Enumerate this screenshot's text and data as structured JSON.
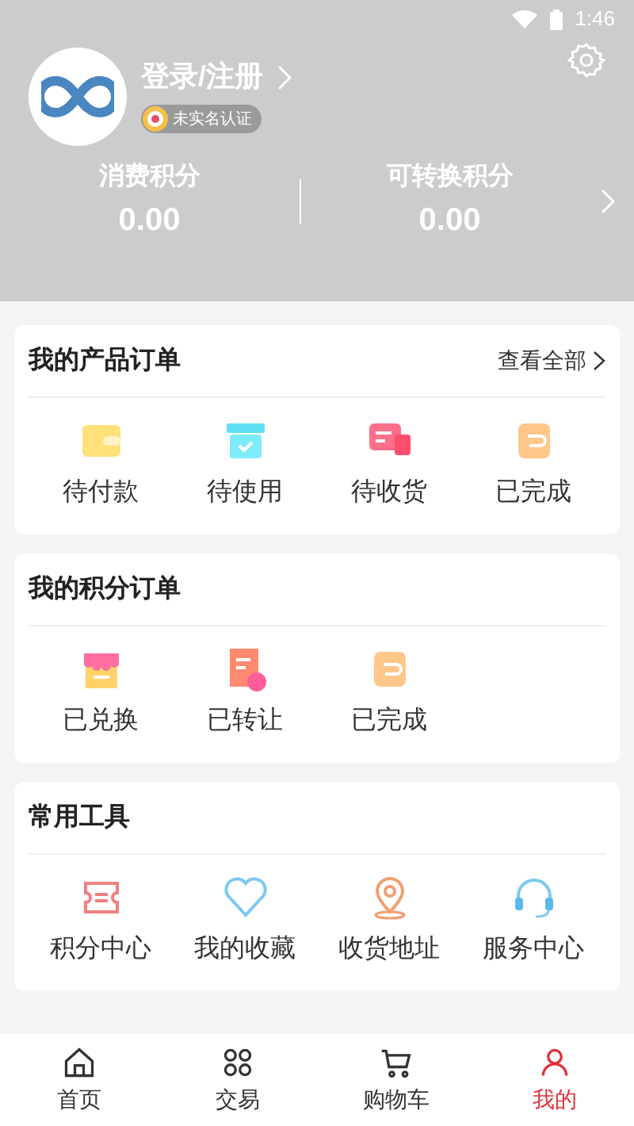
{
  "status_bar": {
    "time": "1:46"
  },
  "profile": {
    "login": "登录/注册",
    "badge": "未实名认证"
  },
  "points": [
    {
      "label": "消费积分",
      "value": "0.00"
    },
    {
      "label": "可转换积分",
      "value": "0.00"
    }
  ],
  "sections": [
    {
      "title": "我的产品订单",
      "more": "查看全部",
      "items": [
        {
          "label": "待付款",
          "kind": "wallet"
        },
        {
          "label": "待使用",
          "kind": "box"
        },
        {
          "label": "待收货",
          "kind": "chat"
        },
        {
          "label": "已完成",
          "kind": "done"
        }
      ]
    },
    {
      "title": "我的积分订单",
      "items": [
        {
          "label": "已兑换",
          "kind": "shop"
        },
        {
          "label": "已转让",
          "kind": "doc"
        },
        {
          "label": "已完成",
          "kind": "done"
        }
      ]
    },
    {
      "title": "常用工具",
      "items": [
        {
          "label": "积分中心",
          "kind": "ticket"
        },
        {
          "label": "我的收藏",
          "kind": "heart"
        },
        {
          "label": "收货地址",
          "kind": "pin"
        },
        {
          "label": "服务中心",
          "kind": "headset"
        }
      ]
    }
  ],
  "tabs": [
    {
      "label": "首页",
      "kind": "home",
      "selected": false
    },
    {
      "label": "交易",
      "kind": "grid",
      "selected": false
    },
    {
      "label": "购物车",
      "kind": "cart",
      "selected": false
    },
    {
      "label": "我的",
      "kind": "user",
      "selected": true
    }
  ]
}
